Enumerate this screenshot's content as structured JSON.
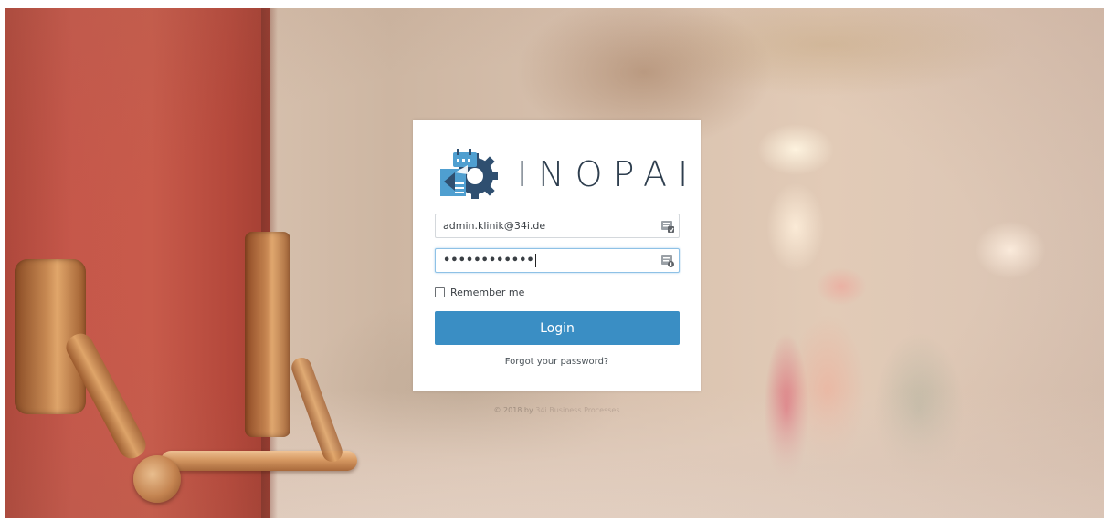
{
  "brand": {
    "name": "INOPAI",
    "text_color": "#2e3e4e",
    "mark_color": "#2f4f70",
    "mark_accent": "#4f9fd0"
  },
  "login_form": {
    "email_value": "admin.klinik@34i.de",
    "password_mask": "••••••••••••",
    "remember_label": "Remember me",
    "remember_checked": false,
    "login_label": "Login",
    "forgot_label": "Forgot your password?",
    "button_color": "#3a8ec4"
  },
  "icons": {
    "email_field_icon": "autofill-card-icon",
    "password_field_icon": "autofill-key-icon"
  },
  "footer": {
    "text_prefix": "© 2018 by",
    "company": "34i Business Processes"
  }
}
